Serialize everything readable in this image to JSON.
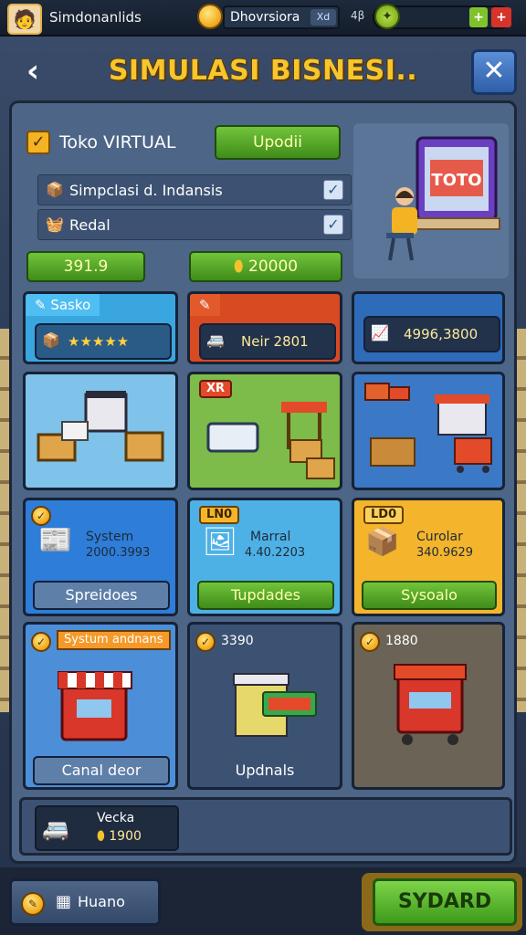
{
  "topbar": {
    "username": "Simdonanlids",
    "currency_label": "Dhovrsiora",
    "currency_x": "Xd",
    "stat_small": "4β"
  },
  "header": {
    "title": "SIMULASI BISNESI.."
  },
  "toko": {
    "title": "Toko VIRTUAL",
    "update_button": "Upodii",
    "options": [
      {
        "label": "Simpclasi d. Indansis",
        "checked": true
      },
      {
        "label": "Redal",
        "checked": true
      }
    ],
    "value_left": "391.9",
    "value_right": "20000",
    "screen_text": "TOTO"
  },
  "row1": [
    {
      "header": "Sasko",
      "stars": "★★★★★",
      "color": "#3aa6e0"
    },
    {
      "header": "",
      "pill": "Neir 2801",
      "color": "#d84a22"
    },
    {
      "header": "",
      "pill": "4996,3800",
      "color": "#2e6bb8"
    }
  ],
  "row3": [
    {
      "name": "System",
      "value": "2000.3993",
      "button": "Spreidoes",
      "bg": "#2e7dd8"
    },
    {
      "tag": "LN0",
      "name": "Marral",
      "value": "4.40.2203",
      "button": "Tupdades",
      "bg": "#4eb1e6"
    },
    {
      "tag": "LD0",
      "name": "Curolar",
      "value": "340.9629",
      "button": "Sysoalo",
      "bg": "#f4b52c"
    }
  ],
  "row4": [
    {
      "tag": "Systum andnans",
      "button": "Canal deor",
      "bg": "#4c8fd8"
    },
    {
      "value": "3390",
      "label": "Updnals",
      "bg": "#3c5272"
    },
    {
      "value": "1880",
      "bg": "#6a6356"
    }
  ],
  "row2_tags": {
    "sign": "XR"
  },
  "bottom_item": {
    "name": "Vecka",
    "value": "1900"
  },
  "footer": {
    "left_label": "Huano",
    "right_button": "SYDARD"
  }
}
